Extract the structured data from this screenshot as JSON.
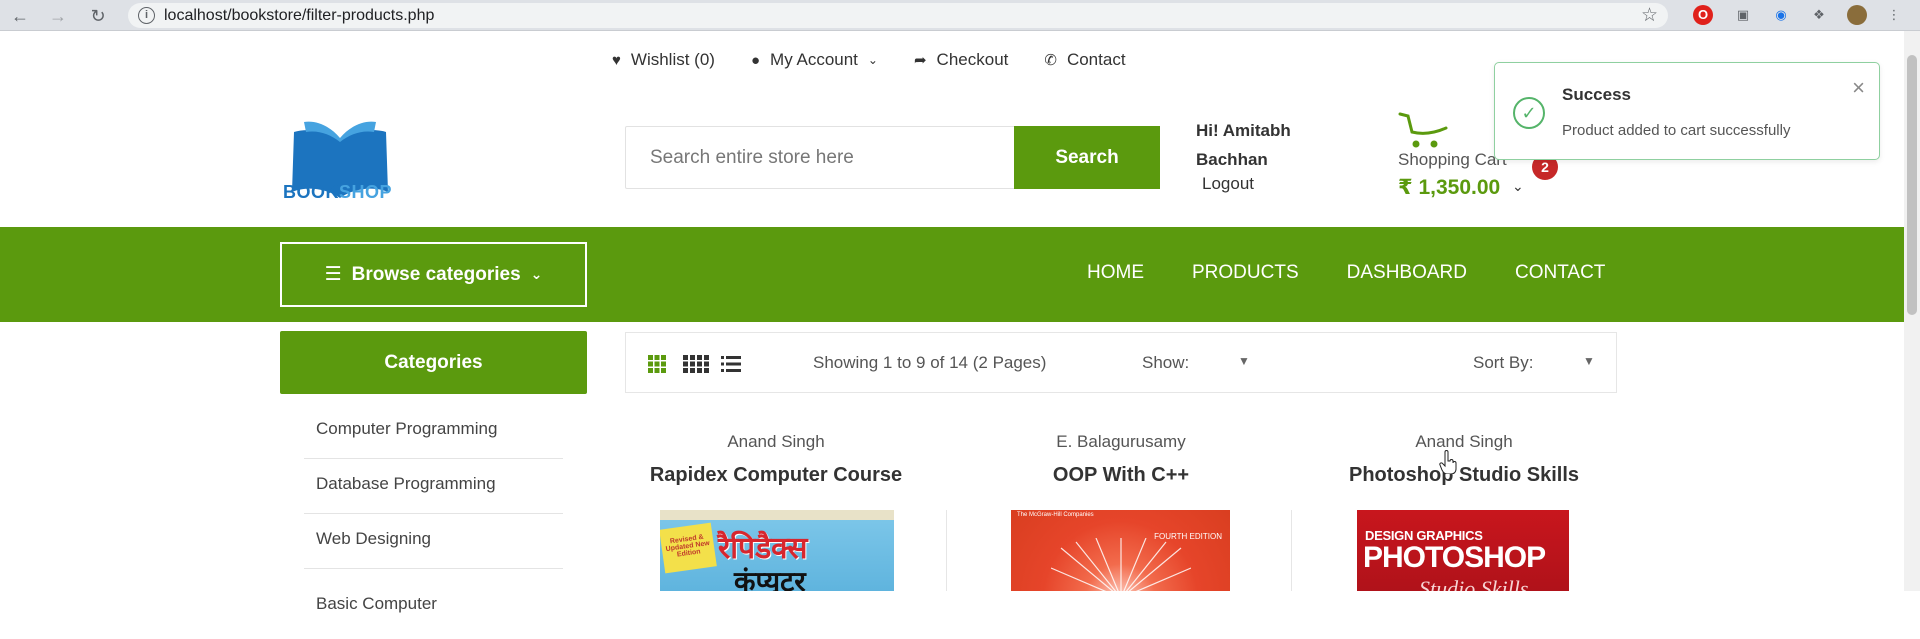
{
  "browser": {
    "url": "localhost/bookstore/filter-products.php"
  },
  "top_links": {
    "wishlist": "Wishlist (0)",
    "account": "My Account",
    "checkout": "Checkout",
    "contact": "Contact"
  },
  "logo": {
    "part1": "BOOK",
    "part2": "SHOP"
  },
  "search": {
    "placeholder": "Search entire store here",
    "button": "Search"
  },
  "user": {
    "greeting_line1": "Hi! Amitabh",
    "greeting_line2": "Bachhan",
    "logout": "Logout"
  },
  "cart": {
    "label": "Shopping Cart",
    "count": "2",
    "total": "₹ 1,350.00"
  },
  "toast": {
    "title": "Success",
    "message": "Product added to cart successfully"
  },
  "nav": {
    "browse": "Browse categories",
    "items": [
      "HOME",
      "PRODUCTS",
      "DASHBOARD",
      "CONTACT"
    ]
  },
  "sidebar": {
    "heading": "Categories",
    "items": [
      "Computer Programming",
      "Database Programming",
      "Web Designing",
      "Basic Computer"
    ]
  },
  "toolbar": {
    "showing": "Showing 1 to 9 of 14 (2 Pages)",
    "show_label": "Show:",
    "sort_label": "Sort By:"
  },
  "products": [
    {
      "author": "Anand Singh",
      "title": "Rapidex Computer Course",
      "cover_text1": "रैपिडैक्स",
      "cover_text2": "कंप्यूटर",
      "cover_tag": "Revised & Updated New Edition"
    },
    {
      "author": "E. Balagurusamy",
      "title": "OOP With C++",
      "cover_text1": "FOURTH EDITION",
      "cover_brand": "The McGraw-Hill Companies"
    },
    {
      "author": "Anand Singh",
      "title": "Photoshop Studio Skills",
      "cover_text1": "DESIGN GRAPHICS",
      "cover_text2": "PHOTOSHOP",
      "cover_text3": "Studio Skills"
    }
  ],
  "colors": {
    "primary_green": "#5b9a0e",
    "badge_red": "#c62828",
    "toast_green": "#55b46a"
  }
}
